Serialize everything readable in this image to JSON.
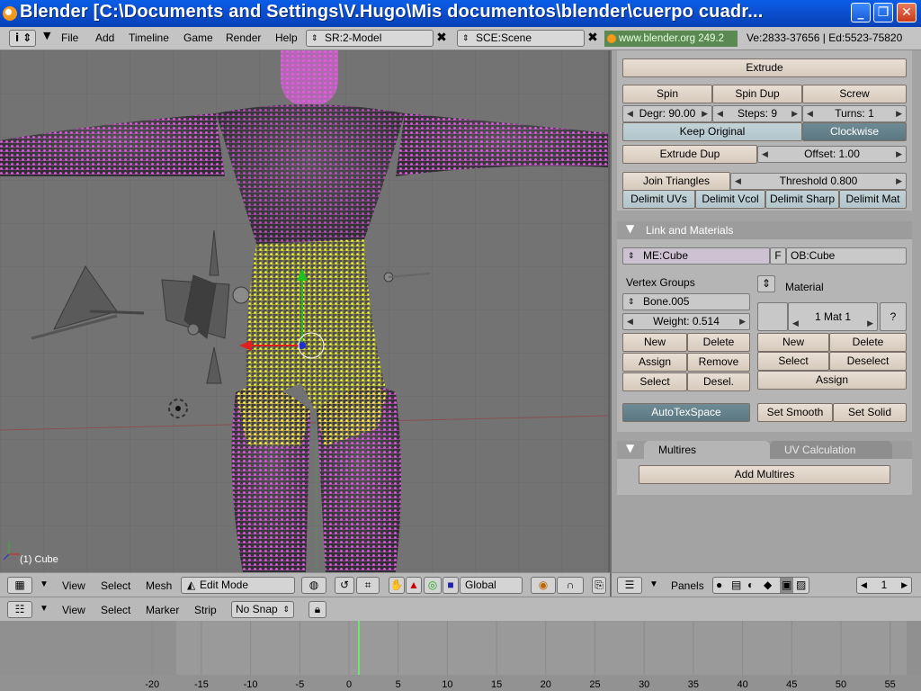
{
  "window": {
    "title": "Blender [C:\\Documents and Settings\\V.Hugo\\Mis documentos\\blender\\cuerpo cuadr...",
    "min_label": "_",
    "max_label": "❐",
    "close_label": "✕"
  },
  "menubar": {
    "items": [
      "File",
      "Add",
      "Timeline",
      "Game",
      "Render",
      "Help"
    ],
    "screen_field": "SR:2-Model",
    "scene_field": "SCE:Scene",
    "url": "www.blender.org 249.2",
    "stats": "Ve:2833-37656 | Ed:5523-75820",
    "close_glyph": "✖"
  },
  "viewport": {
    "object_label": "(1) Cube",
    "colors": {
      "background": "#737373",
      "mesh_unselected": "#e45fe3",
      "mesh_selected": "#ffff40",
      "body_dark": "#404044"
    }
  },
  "viewport_header": {
    "menus": [
      "View",
      "Select",
      "Mesh"
    ],
    "mode": "Edit Mode",
    "orientation": "Global"
  },
  "editing_panel": {
    "extrude": "Extrude",
    "spin": "Spin",
    "spin_dup": "Spin Dup",
    "screw": "Screw",
    "degr": "Degr: 90.00",
    "steps": "Steps: 9",
    "turns": "Turns: 1",
    "keep_original": "Keep Original",
    "clockwise": "Clockwise",
    "extrude_dup": "Extrude Dup",
    "offset": "Offset: 1.00",
    "join_triangles": "Join Triangles",
    "threshold": "Threshold 0.800",
    "delimit": [
      "Delimit UVs",
      "Delimit Vcol",
      "Delimit Sharp",
      "Delimit Mat"
    ]
  },
  "link_materials": {
    "header": "Link and Materials",
    "me_field": "ME:Cube",
    "f_flag": "F",
    "ob_field": "OB:Cube",
    "vertex_groups_label": "Vertex Groups",
    "group_name": "Bone.005",
    "weight": "Weight: 0.514",
    "vg_buttons": [
      "New",
      "Delete",
      "Assign",
      "Remove",
      "Select",
      "Desel."
    ],
    "material_label": "Material",
    "mat_slot": "1 Mat 1",
    "mat_help": "?",
    "mat_buttons": [
      "New",
      "Delete",
      "Select",
      "Deselect"
    ],
    "mat_assign": "Assign",
    "autotex": "AutoTexSpace",
    "set_smooth": "Set Smooth",
    "set_solid": "Set Solid"
  },
  "multires": {
    "tab_active": "Multires",
    "tab_inactive": "UV Calculation",
    "add_button": "Add Multires"
  },
  "panel_header": {
    "label": "Panels",
    "frame": "1"
  },
  "timeline_header": {
    "menus": [
      "View",
      "Select",
      "Marker",
      "Strip"
    ],
    "snap": "No Snap"
  },
  "timeline": {
    "ticks": [
      "-20",
      "-15",
      "-10",
      "-5",
      "0",
      "5",
      "10",
      "15",
      "20",
      "25",
      "30",
      "35",
      "40",
      "45",
      "50",
      "55"
    ],
    "current_frame": 1
  }
}
